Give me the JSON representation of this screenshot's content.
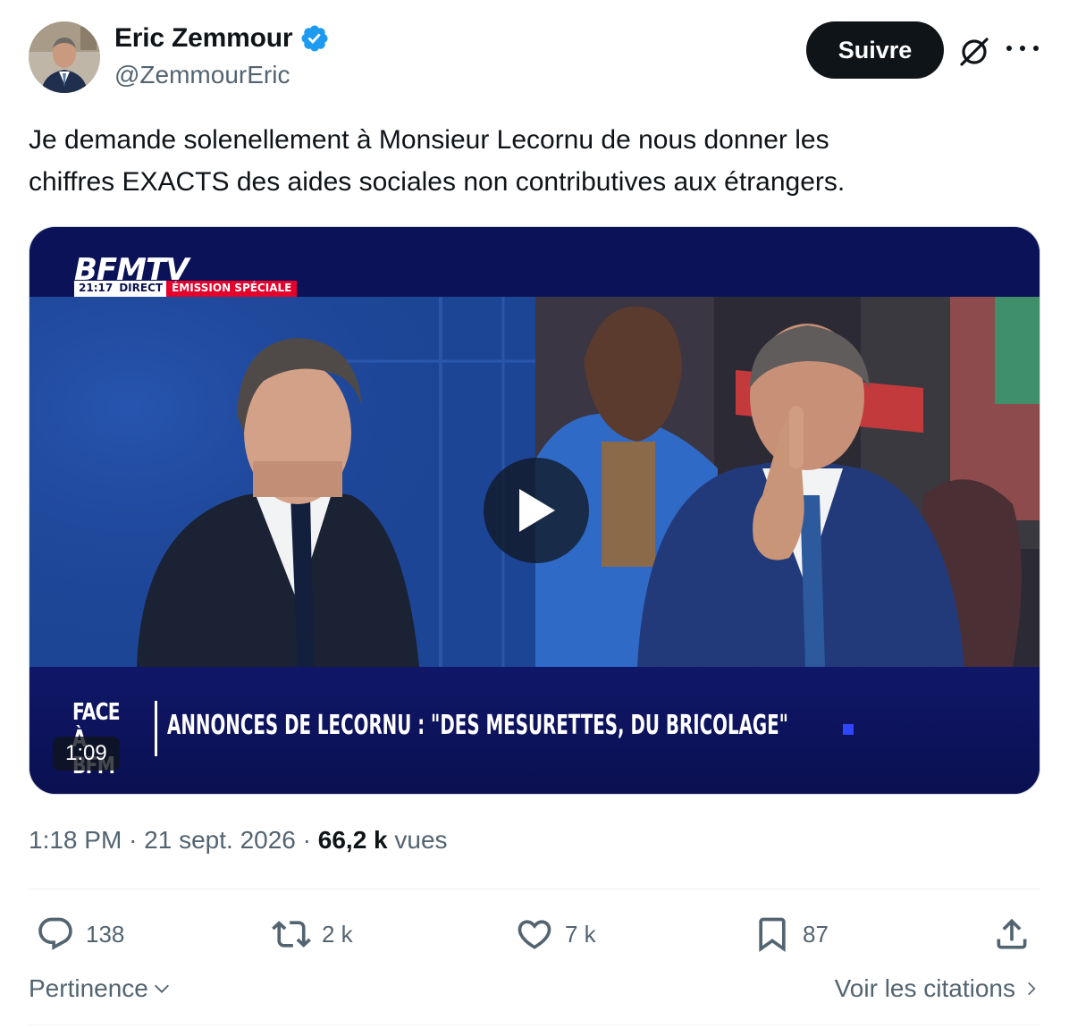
{
  "author": {
    "name": "Eric Zemmour",
    "handle": "@ZemmourEric",
    "verified": true
  },
  "header": {
    "follow_label": "Suivre",
    "icons": [
      "avatar",
      "verified-badge-icon",
      "grok-icon",
      "more-options-icon"
    ]
  },
  "tweet": {
    "text_line1": "Je demande solenellement à Monsieur Lecornu de nous donner les",
    "text_line2": "chiffres EXACTS des aides sociales non contributives aux étrangers."
  },
  "video": {
    "channel": "BFMTV",
    "time": "21:17",
    "live": "DIRECT",
    "program_tag": "ÉMISSION SPÉCIALE",
    "show_name_line1": "FACE À",
    "show_name_line2": "BFM",
    "headline": "ANNONCES DE LECORNU : \"DES MESURETTES, DU BRICOLAGE\"",
    "duration": "1:09",
    "play_icon": "play-icon"
  },
  "meta": {
    "time": "1:18 PM",
    "separator": "·",
    "date": "21 sept. 2026",
    "views_count": "66,2 k",
    "views_label": "vues"
  },
  "actions": {
    "replies": "138",
    "reposts": "2 k",
    "likes": "7 k",
    "bookmarks": "87",
    "icons": [
      "reply-icon",
      "repost-icon",
      "like-icon",
      "bookmark-icon",
      "share-icon"
    ]
  },
  "footer": {
    "sort_label": "Pertinence",
    "quotes_label": "Voir les citations"
  },
  "colors": {
    "text_primary": "#0f1419",
    "text_secondary": "#536471",
    "verified_blue": "#1d9bf0",
    "bfm_red": "#e4002b",
    "bfm_navy": "#0d1450",
    "divider": "#eff3f4"
  }
}
